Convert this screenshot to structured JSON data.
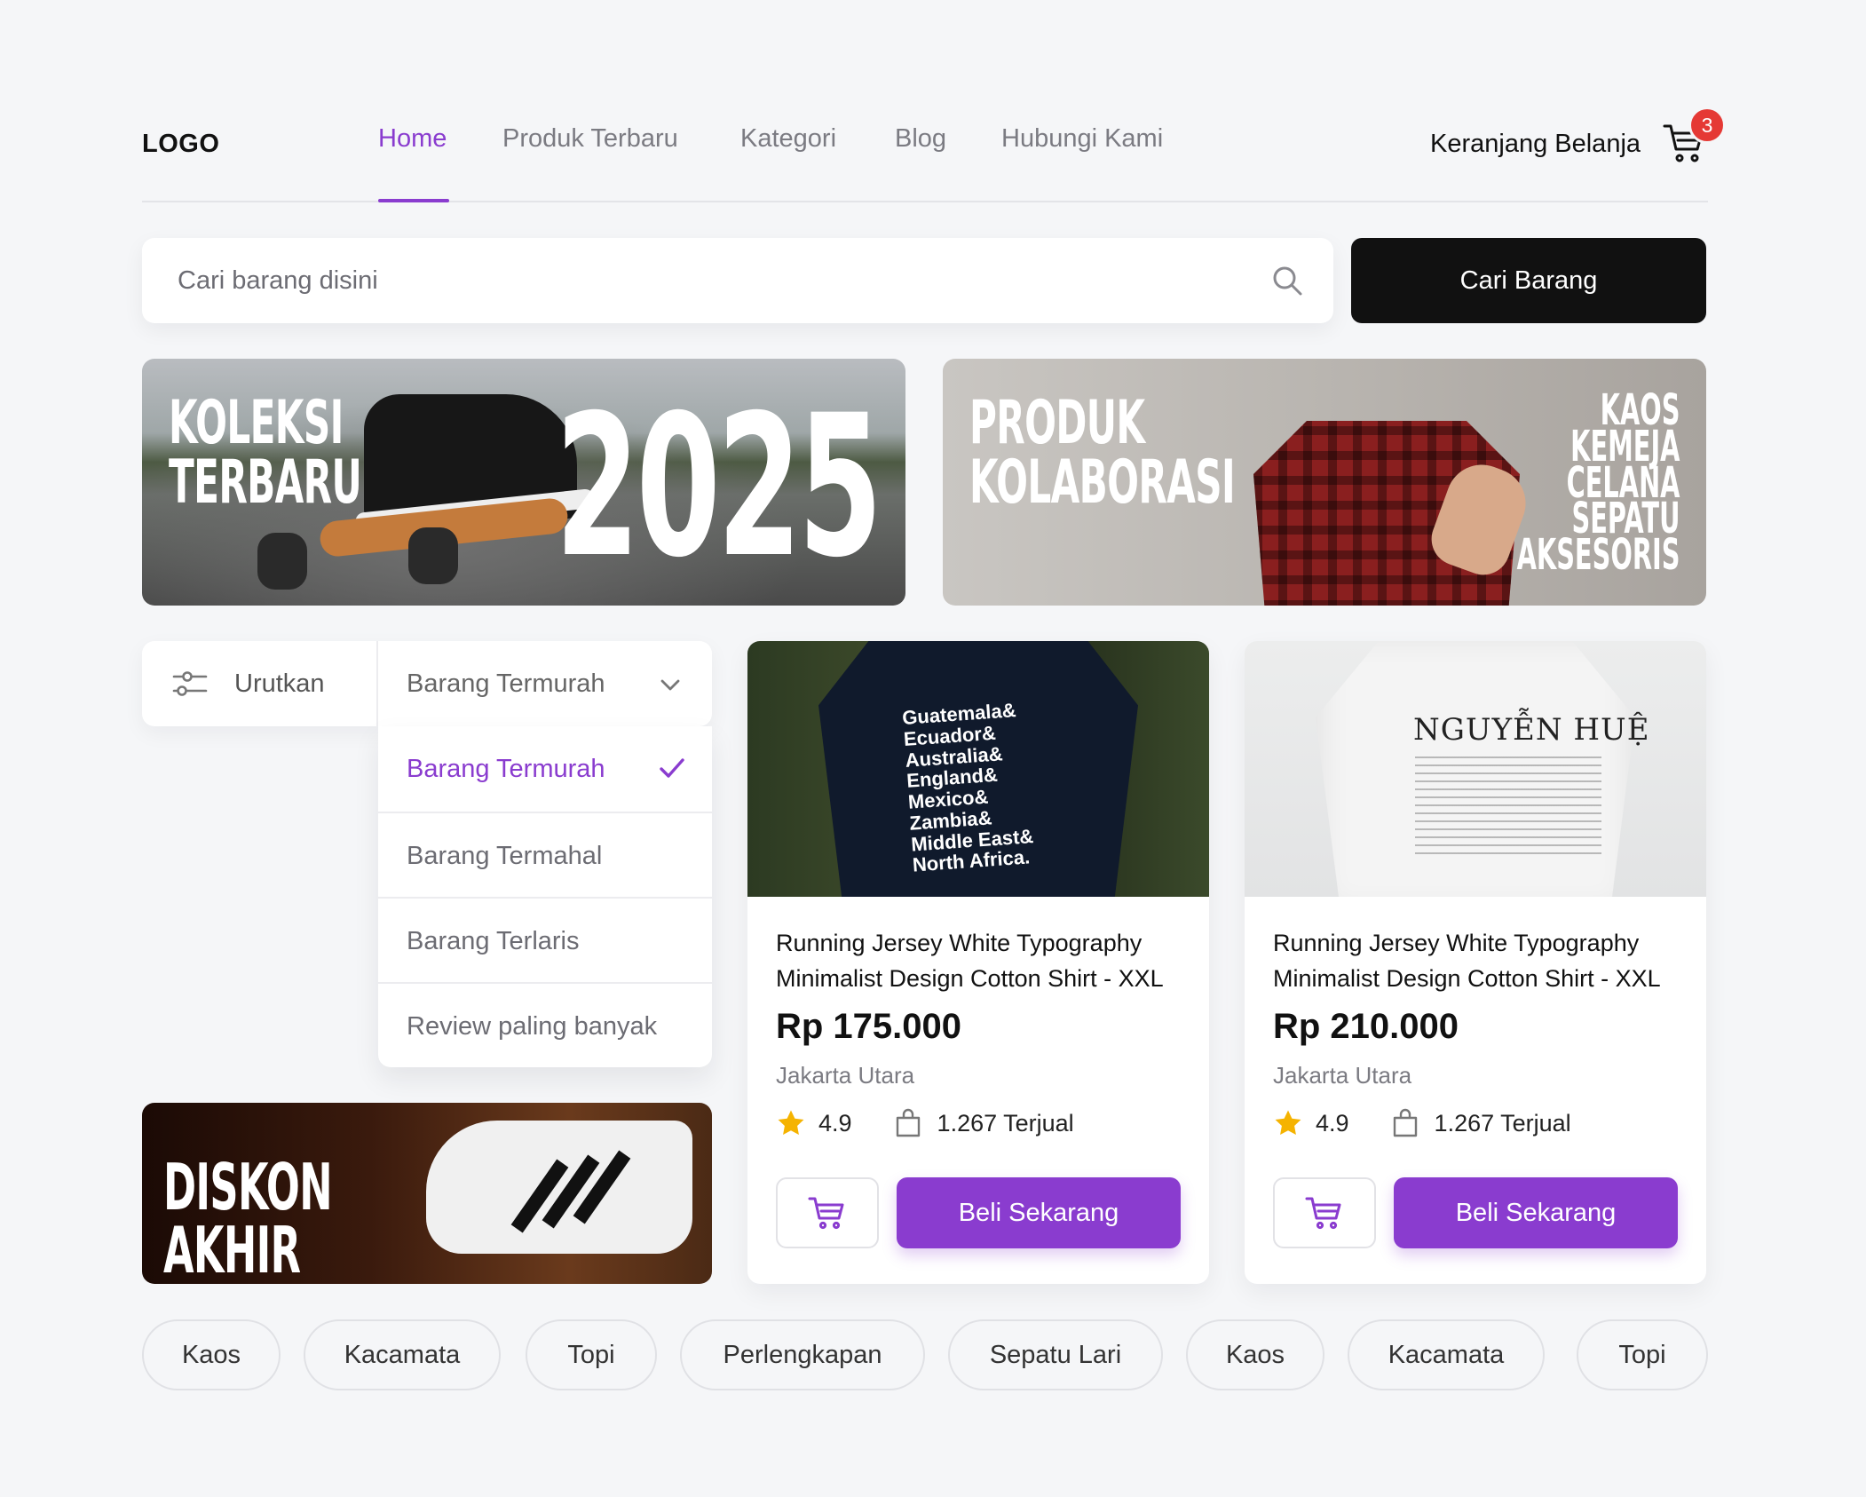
{
  "header": {
    "logo": "LOGO",
    "nav": [
      {
        "label": "Home",
        "active": true
      },
      {
        "label": "Produk Terbaru",
        "active": false
      },
      {
        "label": "Kategori",
        "active": false
      },
      {
        "label": "Blog",
        "active": false
      },
      {
        "label": "Hubungi Kami",
        "active": false
      }
    ],
    "cart_label": "Keranjang Belanja",
    "cart_count": "3",
    "accent_color": "#8a3ccf"
  },
  "search": {
    "placeholder": "Cari barang disini",
    "value": "",
    "button_label": "Cari Barang"
  },
  "banners": {
    "first": {
      "title_line1": "KOLEKSI",
      "title_line2": "TERBARU",
      "year": "2025"
    },
    "second": {
      "title_line1": "PRODUK",
      "title_line2": "KOLABORASI",
      "items": [
        "KAOS",
        "KEMEJA",
        "CELANA",
        "SEPATU",
        "AKSESORIS"
      ]
    },
    "third": {
      "title_line1": "DISKON",
      "title_line2": "AKHIR TAHUN"
    }
  },
  "sort": {
    "label": "Urutkan",
    "selected": "Barang Termurah",
    "options": [
      {
        "label": "Barang Termurah",
        "selected": true
      },
      {
        "label": "Barang Termahal",
        "selected": false
      },
      {
        "label": "Barang Terlaris",
        "selected": false
      },
      {
        "label": "Review paling banyak",
        "selected": false
      }
    ]
  },
  "products": [
    {
      "title": "Running Jersey White Typography Minimalist Design Cotton Shirt - XXL",
      "price": "Rp 175.000",
      "location": "Jakarta Utara",
      "rating": "4.9",
      "sold": "1.267 Terjual",
      "buy_label": "Beli Sekarang",
      "shirt_text": "Guatemala&\nEcuador&\nAustralia&\nEngland&\nMexico&\nZambia&\nMiddle East&\nNorth Africa."
    },
    {
      "title": "Running Jersey White Typography Minimalist Design Cotton Shirt - XXL",
      "price": "Rp 210.000",
      "location": "Jakarta Utara",
      "rating": "4.9",
      "sold": "1.267 Terjual",
      "buy_label": "Beli Sekarang",
      "shirt_text": "NGUYỄN HUỆ"
    }
  ],
  "categories": [
    "Kaos",
    "Kacamata",
    "Topi",
    "Perlengkapan",
    "Sepatu Lari",
    "Kaos",
    "Kacamata",
    "Topi"
  ]
}
